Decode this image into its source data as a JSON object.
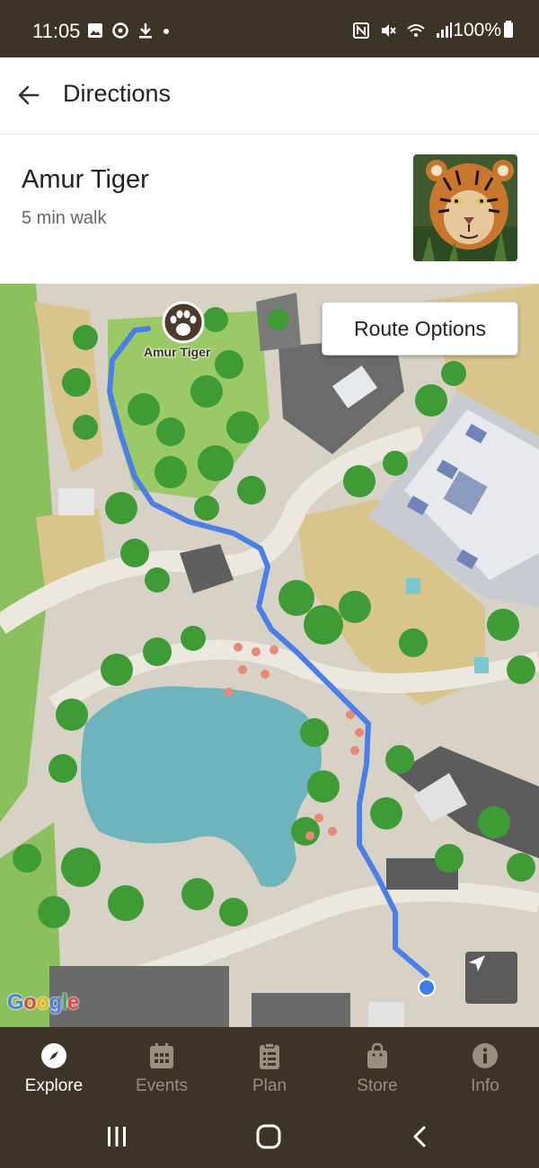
{
  "status_bar": {
    "time": "11:05",
    "battery": "100%",
    "icons_left": [
      "image-icon",
      "sync-icon",
      "download-icon",
      "dot-icon"
    ],
    "icons_right": [
      "nfc-icon",
      "mute-icon",
      "wifi-icon",
      "signal-icon",
      "battery-icon"
    ]
  },
  "app_bar": {
    "title": "Directions",
    "back_icon": "arrow-left-icon"
  },
  "destination": {
    "name": "Amur Tiger",
    "walk_time": "5 min walk"
  },
  "map": {
    "route_options_label": "Route Options",
    "pin_label": "Amur Tiger",
    "google_logo": "Google",
    "route_color": "#4a7fe8",
    "water_color": "#6fb3bd"
  },
  "bottom_nav": {
    "items": [
      {
        "label": "Explore",
        "icon": "compass-icon",
        "active": true
      },
      {
        "label": "Events",
        "icon": "calendar-icon",
        "active": false
      },
      {
        "label": "Plan",
        "icon": "clipboard-icon",
        "active": false
      },
      {
        "label": "Store",
        "icon": "shopping-bag-icon",
        "active": false
      },
      {
        "label": "Info",
        "icon": "info-icon",
        "active": false
      }
    ]
  },
  "colors": {
    "brand_dark": "#3e3327",
    "nav_inactive": "#9a8e80"
  }
}
